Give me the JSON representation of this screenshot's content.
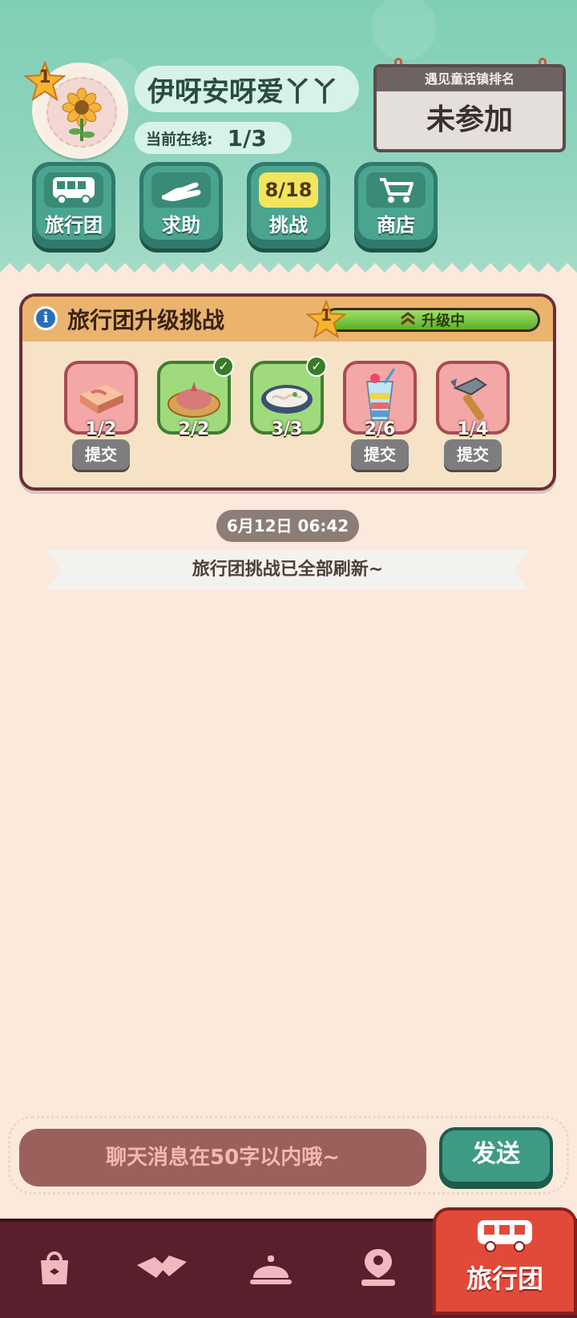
{
  "profile": {
    "level": "1",
    "name": "伊呀安呀爱丫丫",
    "online_label": "当前在线:",
    "online_value": "1/3"
  },
  "ranking": {
    "title": "遇见童话镇排名",
    "status": "未参加"
  },
  "quick_buttons": [
    {
      "label": "旅行团",
      "icon": "bus-icon"
    },
    {
      "label": "求助",
      "icon": "helping-hand-icon"
    },
    {
      "label": "挑战",
      "icon": "challenge-count",
      "count": "8/18"
    },
    {
      "label": "商店",
      "icon": "shopping-cart-icon"
    }
  ],
  "challenge": {
    "title": "旅行团升级挑战",
    "level": "1",
    "progress_label": "升级中",
    "progress_fraction": 1.0,
    "items": [
      {
        "name": "meat-icon",
        "count": "1/2",
        "done": false,
        "submit": "提交"
      },
      {
        "name": "meat-pie-icon",
        "count": "2/2",
        "done": true
      },
      {
        "name": "noodle-bowl-icon",
        "count": "3/3",
        "done": true
      },
      {
        "name": "parfait-drink-icon",
        "count": "2/6",
        "done": false,
        "submit": "提交"
      },
      {
        "name": "hammer-icon",
        "count": "1/4",
        "done": false,
        "submit": "提交"
      }
    ]
  },
  "chat": {
    "timestamp": "6月12日 06:42",
    "system_message": "旅行团挑战已全部刷新~",
    "input_placeholder": "聊天消息在50字以内哦~",
    "send_label": "发送"
  },
  "bottom_nav": {
    "items": [
      "shopping-bag-icon",
      "handshake-icon",
      "service-bell-icon",
      "map-pin-person-icon"
    ],
    "active_label": "旅行团"
  },
  "colors": {
    "header_green": "#8fd4bd",
    "panel_border": "#6d2d38",
    "nav_bg": "#5a1f2c",
    "nav_active": "#e14a39",
    "send_green": "#3d9b84"
  }
}
